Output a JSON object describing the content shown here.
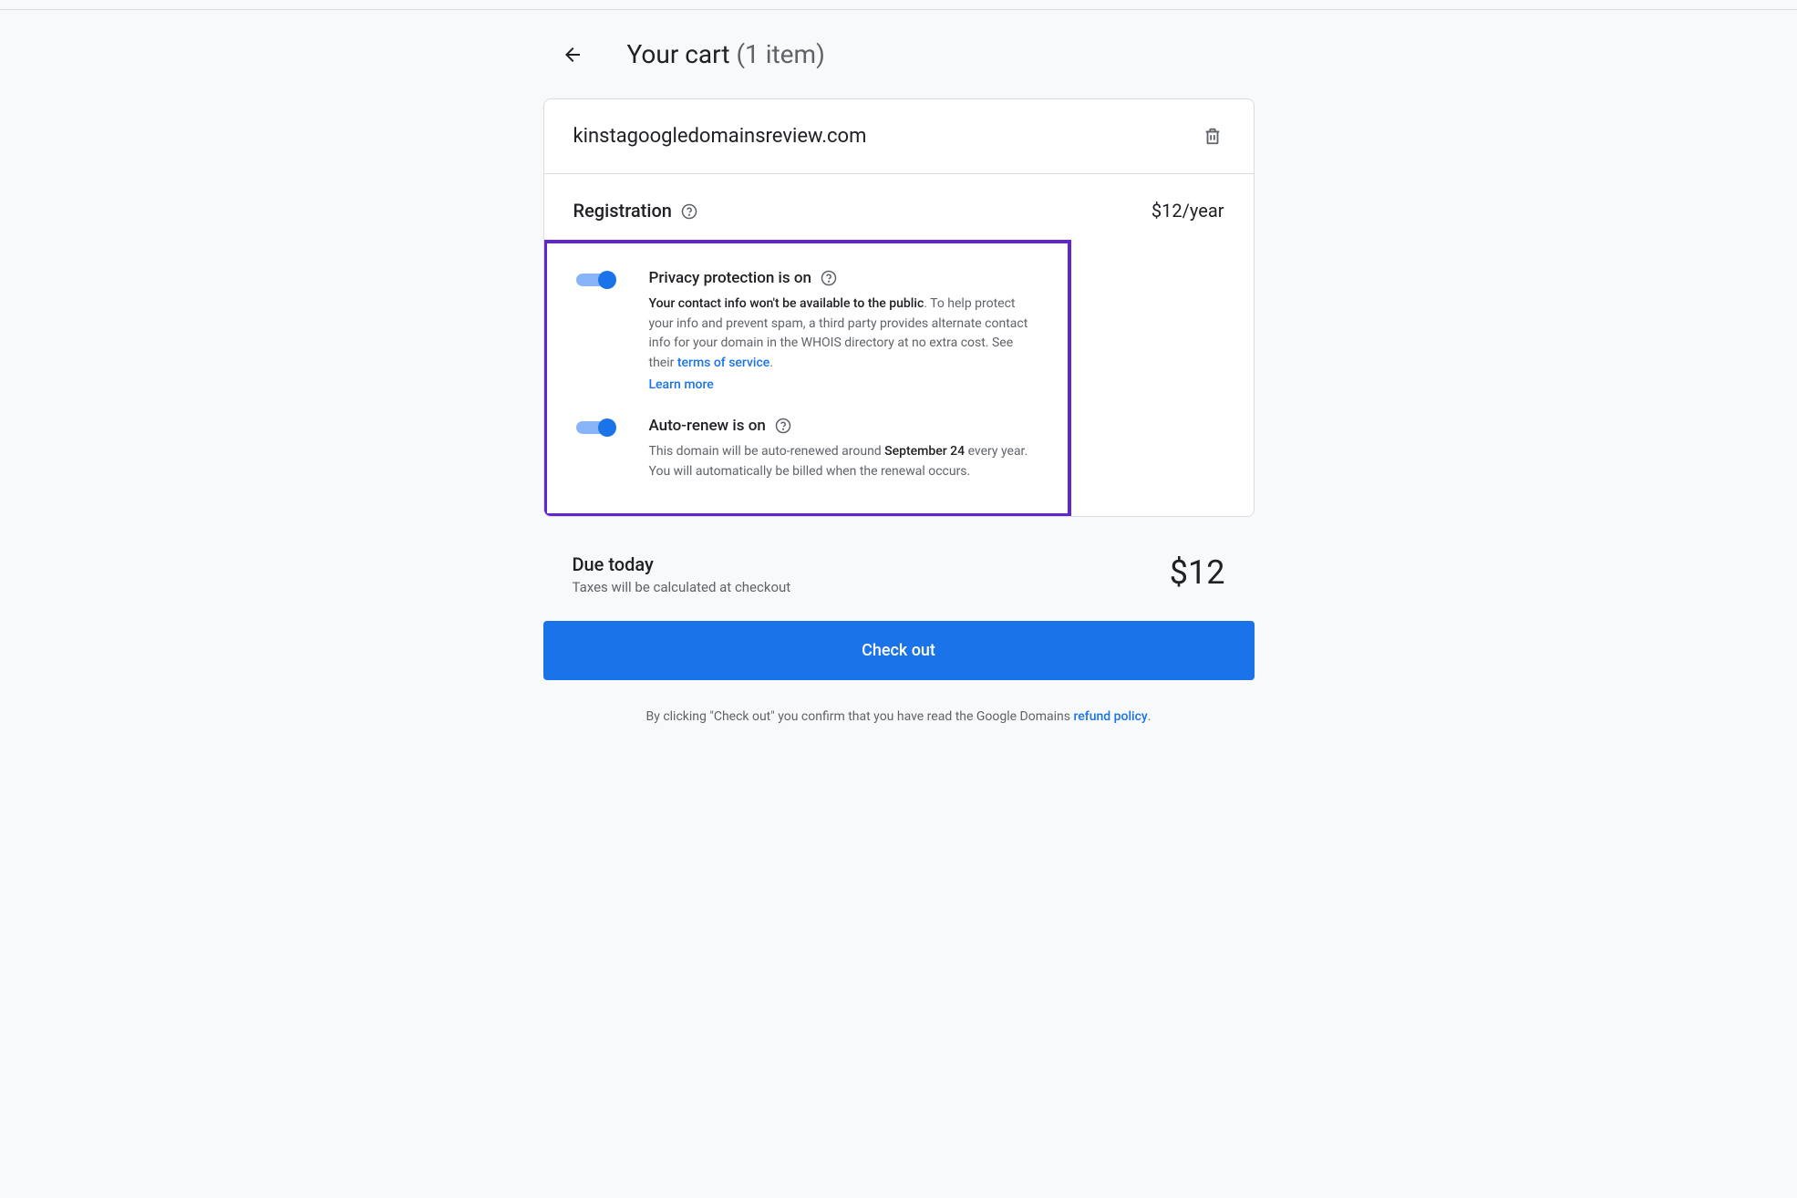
{
  "header": {
    "title": "Your cart",
    "item_count": "(1 item)"
  },
  "cart": {
    "domain": "kinstagoogledomainsreview.com",
    "registration_label": "Registration",
    "price": "$12/year"
  },
  "privacy": {
    "title": "Privacy protection is on",
    "desc_bold": "Your contact info won't be available to the public",
    "desc_rest": ". To help protect your info and prevent spam, a third party provides alternate contact info for your domain in the WHOIS directory at no extra cost. See their ",
    "tos_link": "terms of service",
    "period": ".",
    "learn_more": "Learn more"
  },
  "autorenew": {
    "title": "Auto-renew is on",
    "desc_pre": "This domain will be auto-renewed around ",
    "date": "September 24",
    "desc_post": " every year. You will automatically be billed when the renewal occurs."
  },
  "due": {
    "title": "Due today",
    "subtitle": "Taxes will be calculated at checkout",
    "amount": "$12"
  },
  "checkout": {
    "button": "Check out",
    "disclaimer_pre": "By clicking \"Check out\" you confirm that you have read the Google Domains ",
    "refund_link": "refund policy",
    "period": "."
  }
}
